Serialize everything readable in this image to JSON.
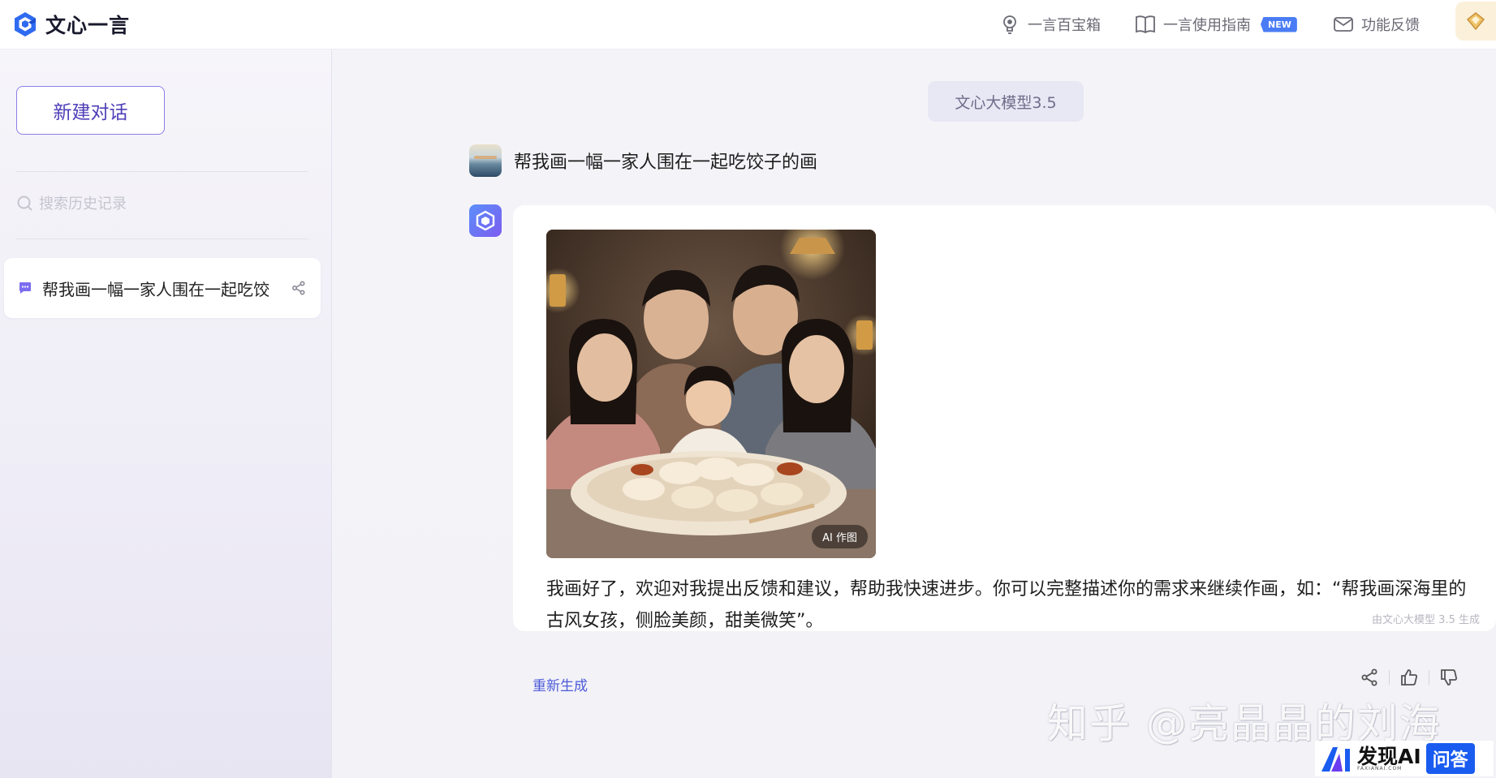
{
  "app": {
    "name": "文心一言"
  },
  "header": {
    "nav": [
      {
        "label": "一言百宝箱",
        "icon": "lightbulb-icon"
      },
      {
        "label": "一言使用指南",
        "icon": "book-icon",
        "badge": "NEW"
      },
      {
        "label": "功能反馈",
        "icon": "mail-icon"
      }
    ],
    "vip_icon": "diamond-icon"
  },
  "sidebar": {
    "new_chat_label": "新建对话",
    "search_placeholder": "搜索历史记录",
    "history": [
      {
        "title": "帮我画一幅一家人围在一起吃饺",
        "icon": "chat-icon",
        "action_icon": "share-icon"
      }
    ]
  },
  "main": {
    "model_label": "文心大模型3.5",
    "user_message": "帮我画一幅一家人围在一起吃饺子的画",
    "image_tag": "AI 作图",
    "answer_text": "我画好了，欢迎对我提出反馈和建议，帮助我快速进步。你可以完整描述你的需求来继续作画，如：“帮我画深海里的古风女孩，侧脸美颜，甜美微笑”。",
    "generated_by": "由文心大模型 3.5 生成",
    "regenerate_label": "重新生成",
    "actions": [
      "share-icon",
      "thumbs-up-icon",
      "thumbs-down-icon"
    ]
  },
  "watermark": {
    "zhihu": "知乎 @亮晶晶的刘海",
    "brand": "发现AI",
    "brand_sub": "FAXIANAI.COM",
    "ask": "问答"
  },
  "colors": {
    "accent": "#4d3fb8",
    "link": "#4d5bd8",
    "badge": "#4a7cf6"
  }
}
